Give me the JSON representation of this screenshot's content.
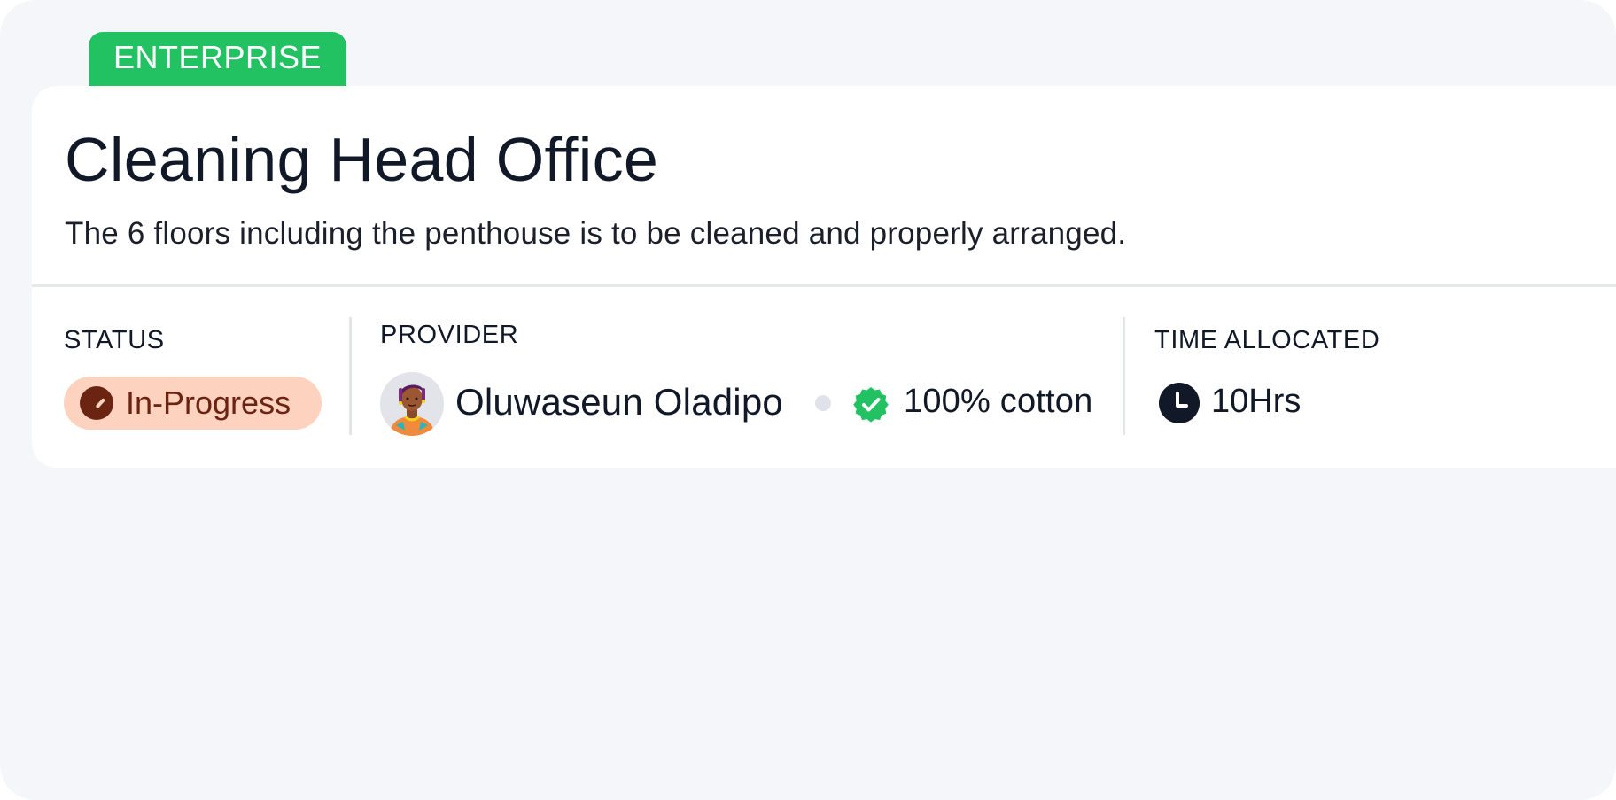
{
  "job": {
    "tier": "ENTERPRISE",
    "title": "Cleaning Head Office",
    "description": "The 6 floors including the penthouse is to be cleaned and properly arranged."
  },
  "status": {
    "label": "STATUS",
    "value": "In-Progress",
    "icon": "progress-icon",
    "color": "#6b2412",
    "background": "#fdd3bf"
  },
  "provider": {
    "label": "PROVIDER",
    "name": "Oluwaseun Oladipo",
    "avatar_icon": "avatar",
    "verified_icon": "verified-badge-icon",
    "material": "100% cotton"
  },
  "time": {
    "label": "TIME ALLOCATED",
    "value": "10Hrs",
    "icon": "clock-icon"
  },
  "colors": {
    "tier_badge": "#22c263",
    "verified": "#22c263",
    "page_background": "#f5f6fa"
  }
}
